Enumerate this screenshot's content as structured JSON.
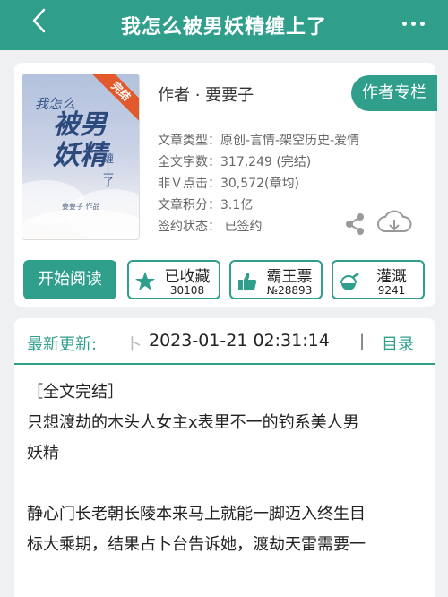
{
  "header": {
    "back_icon": "chevron-left-icon",
    "title": "我怎么被男妖精缠上了",
    "more_icon": "more-dots-icon"
  },
  "book": {
    "cover": {
      "title_small": "我怎么",
      "title_big": "被男妖精",
      "title_tail": "缠上了",
      "author_line": "要要子 作品",
      "badge": "完结"
    },
    "author": "作者 · 要要子",
    "author_column_button": "作者专栏",
    "meta": [
      "文章类型：原创-言情-架空历史-爱情",
      "全文字数：317,249 (完结)",
      "非Ｖ点击：30,572(章均)",
      "文章积分：3.1亿",
      "签约状态：  已签约"
    ],
    "share_icon": "share-icon",
    "download_icon": "cloud-download-icon"
  },
  "actions": {
    "read": "开始阅读",
    "favorite": {
      "label": "已收藏",
      "count": "30108",
      "icon": "star-icon"
    },
    "vote": {
      "label": "霸王票",
      "count": "№28893",
      "icon": "thumbs-up-icon"
    },
    "water": {
      "label": "灌溉",
      "count": "9241",
      "icon": "nutrient-flask-icon"
    }
  },
  "update": {
    "label": "最新更新:",
    "separator": "卜",
    "time": "2023-01-21 02:31:14",
    "divider": "|",
    "catalog": "目录"
  },
  "content": {
    "line1": "［全文完结］",
    "line2": "只想渡劫的木头人女主x表里不一的钓系美人男",
    "line3": "妖精",
    "line4": "静心门长老朝长陵本来马上就能一脚迈入终生目",
    "line5": "标大乘期，结果占卜台告诉她，渡劫天雷需要一"
  },
  "colors": {
    "accent": "#2f9f8c",
    "badge": "#e2592c",
    "background": "#eef0f1"
  }
}
